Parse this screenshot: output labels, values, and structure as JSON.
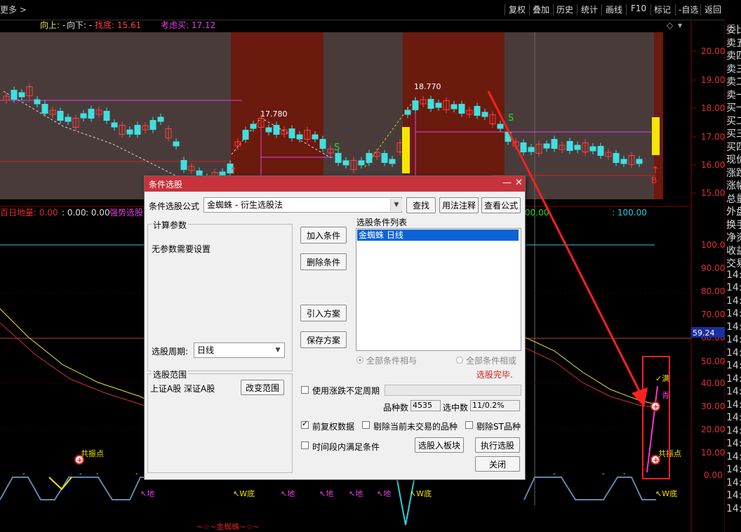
{
  "toolbar": {
    "more": "更多 >",
    "buttons": [
      "复权",
      "叠加",
      "历史",
      "统计",
      "画线",
      "F10",
      "标记",
      "-自选",
      "返回"
    ]
  },
  "price_header": {
    "up_label": "向上: -",
    "down_label": "向下: -",
    "dip_label": "找底: 15.61",
    "tiger_label": "考虑买: 17.12"
  },
  "price_axis": [
    "20.00",
    "19.00",
    "18.00",
    "17.00",
    "16.00",
    "15.00"
  ],
  "price_annotations": {
    "high1": "17.780",
    "high2": "18.770",
    "s1": "S",
    "s2": "S",
    "b1": "B"
  },
  "indicator_header": {
    "name": "百日地量: 0.00",
    "v2": ": 0.00",
    "v3": ": 0.00",
    "strong": "强势选股",
    "right_a": "00.00",
    "right_b": ": 100.00"
  },
  "indicator_axis": [
    "100.0",
    "90.00",
    "80.00",
    "70.00",
    "60.00",
    "50.00",
    "40.00",
    "30.00",
    "20.00",
    "10.00",
    "0.00"
  ],
  "indicator_current": "59.24",
  "indicator_labels": {
    "resonance_left": "共振点",
    "resonance_right": "共振点",
    "full": "✓满",
    "green": "青",
    "di1": "↖地",
    "wdi1": "↖W底",
    "di2": "↖地",
    "di3": "↖地",
    "di4": "↖地",
    "di5": "↖地",
    "wdi2": "↖W底",
    "wdi3": "↖W底",
    "spider": "~☆~金蜘蛛~☆~"
  },
  "right_panel": [
    "委比",
    "卖五",
    "卖四",
    "卖三",
    "卖二",
    "卖一",
    "买一",
    "买二",
    "买三",
    "买四",
    "现价",
    "涨跌",
    "涨幅",
    "总量",
    "外盘",
    "换手",
    "净资",
    "收益",
    "交易",
    "14:",
    "14:",
    "14:",
    "14:",
    "14:",
    "14:",
    "14:",
    "14:",
    "14:",
    "14:",
    "14:",
    "14:",
    "14:",
    "14:",
    "14:",
    "14:",
    "14:",
    "14:",
    "14:"
  ],
  "dialog": {
    "title": "条件选股",
    "formula_label": "条件选股公式",
    "formula_value": "金蜘蛛         - 衍生选股法",
    "find_btn": "查找",
    "usage_btn": "用法注释",
    "view_btn": "查看公式",
    "calc_group": "计算参数",
    "no_params": "无参数需要设置",
    "period_label": "选股周期:",
    "period_value": "日线",
    "range_group": "选股范围",
    "range_value": "上证A股  深证A股",
    "change_range_btn": "改变范围",
    "add_btn": "加入条件",
    "del_btn": "删除条件",
    "import_btn": "引入方案",
    "save_btn": "保存方案",
    "list_label": "选股条件列表",
    "list_items": [
      "金蜘蛛   日线"
    ],
    "radio_and": "全部条件相与",
    "radio_or": "全部条件相或",
    "done": "选股完毕.",
    "use_period_label": "使用涨跌不定周期",
    "count_label": "品种数",
    "count_value": "4535",
    "selected_label": "选中数",
    "selected_value": "11/0.2%",
    "pre_adj_label": "前复权数据",
    "exclude_untraded_label": "剔除当前未交易的品种",
    "exclude_st_label": "剔除ST品种",
    "time_cond_label": "时间段内满足条件",
    "to_block_btn": "选股入板块",
    "run_btn": "执行选股",
    "close_btn": "关闭"
  }
}
